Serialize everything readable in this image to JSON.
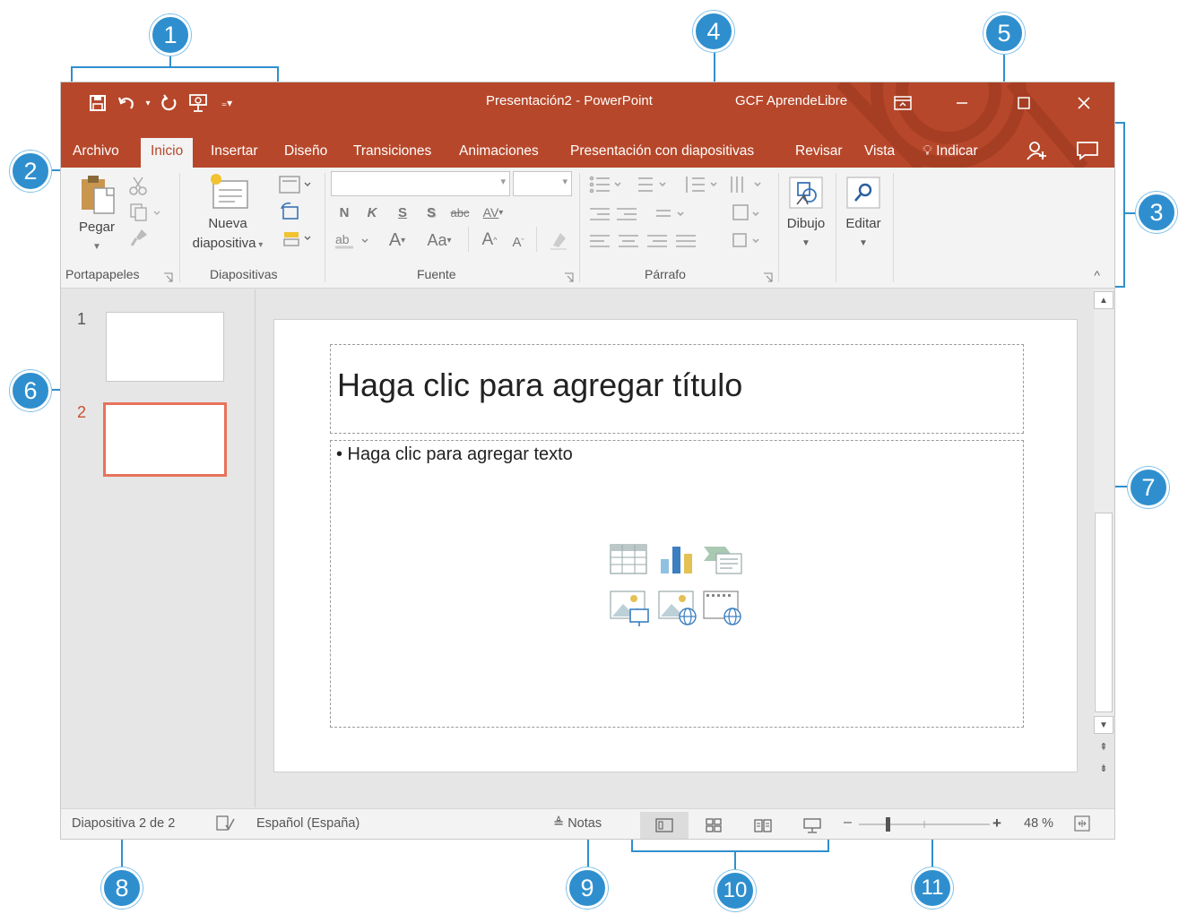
{
  "window": {
    "title": "Presentación2  -  PowerPoint",
    "brand": "GCF AprendeLibre",
    "colors": {
      "accent": "#b7472a",
      "ribbon": "#f3f3f3",
      "callout": "#2f8fce"
    }
  },
  "quick_access": {
    "icons": [
      "save-icon",
      "undo-icon",
      "redo-icon",
      "start-from-beginning-icon",
      "customize-toolbar-icon"
    ]
  },
  "ribbon_tabs": [
    "Archivo",
    "Inicio",
    "Insertar",
    "Diseño",
    "Transiciones",
    "Animaciones",
    "Presentación con diapositivas",
    "Revisar",
    "Vista"
  ],
  "tell_me": "Indicar",
  "ribbon": {
    "paste_label": "Pegar",
    "new_slide_label_1": "Nueva",
    "new_slide_label_2": "diapositiva",
    "draw_label": "Dibujo",
    "edit_label": "Editar",
    "bold": "N",
    "italic": "K",
    "underline": "S",
    "shadow": "S",
    "strike": "abc",
    "spacing": "AV",
    "font_color": "A",
    "case": "Aa",
    "grow": "A",
    "shrink": "A",
    "groups": {
      "clipboard": "Portapapeles",
      "slides": "Diapositivas",
      "font": "Fuente",
      "paragraph": "Párrafo"
    }
  },
  "thumbnails": [
    {
      "number": "1"
    },
    {
      "number": "2",
      "selected": true
    }
  ],
  "slide": {
    "title_placeholder": "Haga clic para agregar título",
    "body_placeholder": "• Haga clic para agregar texto"
  },
  "status_bar": {
    "slide_info": "Diapositiva 2 de 2",
    "language": "Español (España)",
    "notes": "Notas",
    "zoom": "48 %"
  },
  "callouts": [
    "1",
    "2",
    "3",
    "4",
    "5",
    "6",
    "7",
    "8",
    "9",
    "10",
    "11"
  ]
}
